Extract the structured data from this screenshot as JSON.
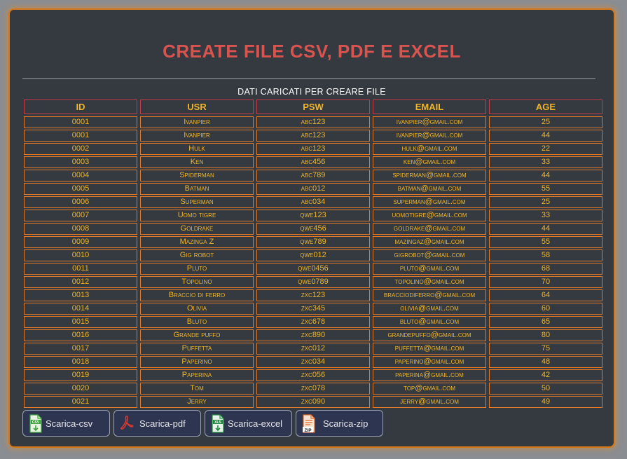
{
  "title": "CREATE FILE CSV, PDF E EXCEL",
  "subtitle": "DATI CARICATI PER CREARE FILE",
  "table": {
    "columns": [
      "ID",
      "USR",
      "PSW",
      "EMAIL",
      "AGE"
    ],
    "rows": [
      [
        "0001",
        "Ivanpier",
        "abc123",
        "ivanpier@gmail.com",
        "25"
      ],
      [
        "0001",
        "Ivanpier",
        "abc123",
        "ivanpier@gmail.com",
        "44"
      ],
      [
        "0002",
        "Hulk",
        "abc123",
        "hulk@gmail.com",
        "22"
      ],
      [
        "0003",
        "Ken",
        "abc456",
        "ken@gmail.com",
        "33"
      ],
      [
        "0004",
        "Spiderman",
        "abc789",
        "spiderman@gmail.com",
        "44"
      ],
      [
        "0005",
        "Batman",
        "abc012",
        "batman@gmail.com",
        "55"
      ],
      [
        "0006",
        "Superman",
        "abc034",
        "superman@gmail.com",
        "25"
      ],
      [
        "0007",
        "Uomo tigre",
        "qwe123",
        "uomotigre@gmail.com",
        "33"
      ],
      [
        "0008",
        "Goldrake",
        "qwe456",
        "goldrake@gmail.com",
        "44"
      ],
      [
        "0009",
        "Mazinga Z",
        "qwe789",
        "mazingaz@gmail.com",
        "55"
      ],
      [
        "0010",
        "Gig robot",
        "qwe012",
        "gigrobot@gmail.com",
        "58"
      ],
      [
        "0011",
        "Pluto",
        "qwe0456",
        "pluto@gmail.com",
        "68"
      ],
      [
        "0012",
        "Topolino",
        "qwe0789",
        "topolino@gmail.com",
        "70"
      ],
      [
        "0013",
        "Braccio di ferro",
        "zxc123",
        "bracciodiferro@gmail.com",
        "64"
      ],
      [
        "0014",
        "Olivia",
        "zxc345",
        "olivia@gmail.com",
        "60"
      ],
      [
        "0015",
        "Bluto",
        "zxc678",
        "bluto@gmail.com",
        "65"
      ],
      [
        "0016",
        "Grande puffo",
        "zxc890",
        "grandepuffo@gmail.com",
        "80"
      ],
      [
        "0017",
        "Puffetta",
        "zxc012",
        "puffetta@gmail.com",
        "75"
      ],
      [
        "0018",
        "Paperino",
        "zxc034",
        "paperino@gmail.com",
        "48"
      ],
      [
        "0019",
        "Paperina",
        "zxc056",
        "paperina@gmail.com",
        "42"
      ],
      [
        "0020",
        "Tom",
        "zxc078",
        "top@gmail.com",
        "50"
      ],
      [
        "0021",
        "Jerry",
        "zxc090",
        "jerry@gmail.com",
        "49"
      ]
    ]
  },
  "buttons": [
    {
      "label": "Scarica-csv",
      "icon": "csv-file-icon",
      "icon_text": "CSV"
    },
    {
      "label": "Scarica-pdf",
      "icon": "pdf-icon",
      "icon_text": ""
    },
    {
      "label": "Scarica-excel",
      "icon": "excel-file-icon",
      "icon_text": "XLS"
    },
    {
      "label": "Scarica-zip",
      "icon": "zip-file-icon",
      "icon_text": "ZIP"
    }
  ],
  "colors": {
    "title": "#d9534f",
    "cell_text": "#f0b429",
    "header_border": "#c83a4a",
    "cell_border": "#e07a2a",
    "panel": "#343a40",
    "panel_glow": "#d4781c",
    "button_bg": "#2e3550"
  }
}
